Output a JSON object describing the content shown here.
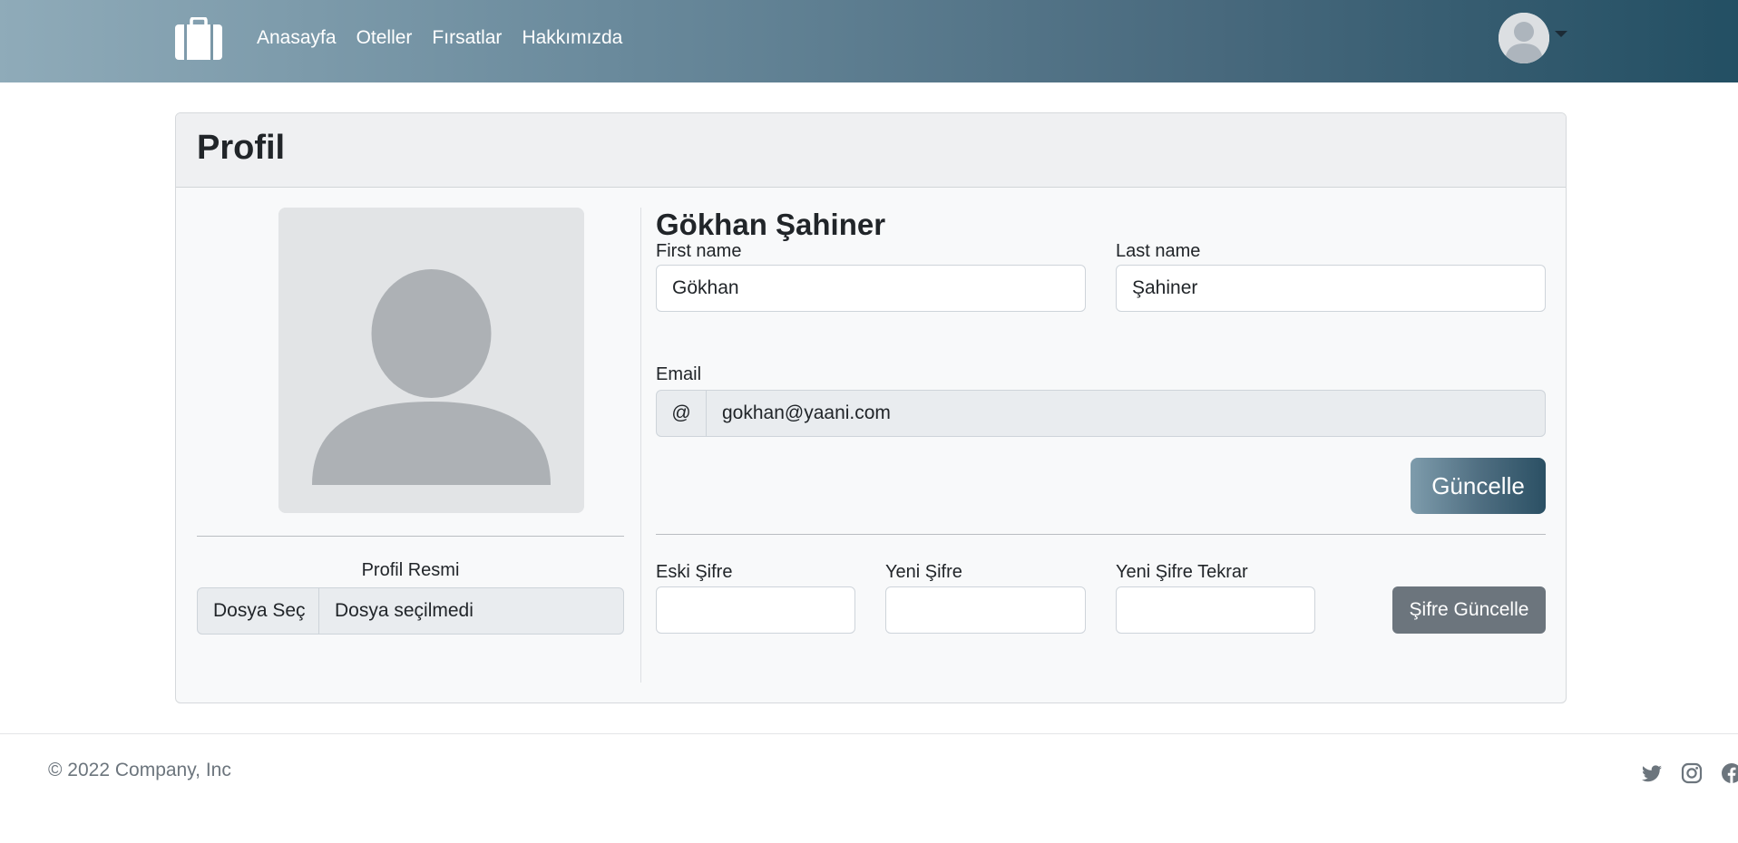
{
  "nav": {
    "brand_icon": "briefcase-icon",
    "links": [
      "Anasayfa",
      "Oteller",
      "Fırsatlar",
      "Hakkımızda"
    ],
    "user_icon": "user-avatar-icon"
  },
  "profile": {
    "title": "Profil",
    "photo_label": "Profil Resmi",
    "file_button": "Dosya Seç",
    "file_status": "Dosya seçilmedi",
    "full_name": "Gökhan Şahiner",
    "first_name_label": "First name",
    "first_name_value": "Gökhan",
    "last_name_label": "Last name",
    "last_name_value": "Şahiner",
    "email_label": "Email",
    "email_prefix": "@",
    "email_value": "gokhan@yaani.com",
    "update_button": "Güncelle",
    "old_password_label": "Eski Şifre",
    "new_password_label": "Yeni Şifre",
    "new_password_repeat_label": "Yeni Şifre Tekrar",
    "password_button": "Şifre Güncelle"
  },
  "footer": {
    "copyright": "© 2022 Company, Inc",
    "social_icons": [
      "twitter-icon",
      "instagram-icon",
      "facebook-icon"
    ]
  },
  "colors": {
    "nav_gradient_start": "#8fabb9",
    "nav_gradient_end": "#234f63",
    "secondary_button": "#6c757d"
  }
}
